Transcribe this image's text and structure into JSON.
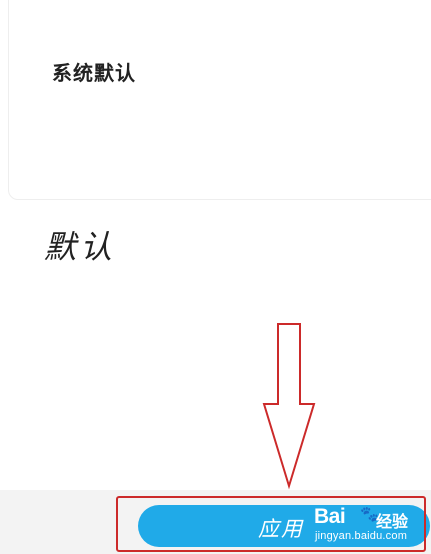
{
  "font_option": {
    "label": "系统默认"
  },
  "preview": {
    "text": "默认"
  },
  "apply_button": {
    "label": "应用"
  },
  "watermark": {
    "brand": "Bai",
    "paw": "🐾",
    "sub": "经验",
    "url": "jingyan.baidu.com"
  },
  "colors": {
    "button_blue": "#20aae8",
    "annotation_red": "#cc2a2a",
    "bottom_bar": "#f3f3f3"
  },
  "annotation": {
    "arrow_icon": "down-arrow-icon",
    "highlight": "red-outline-box"
  }
}
